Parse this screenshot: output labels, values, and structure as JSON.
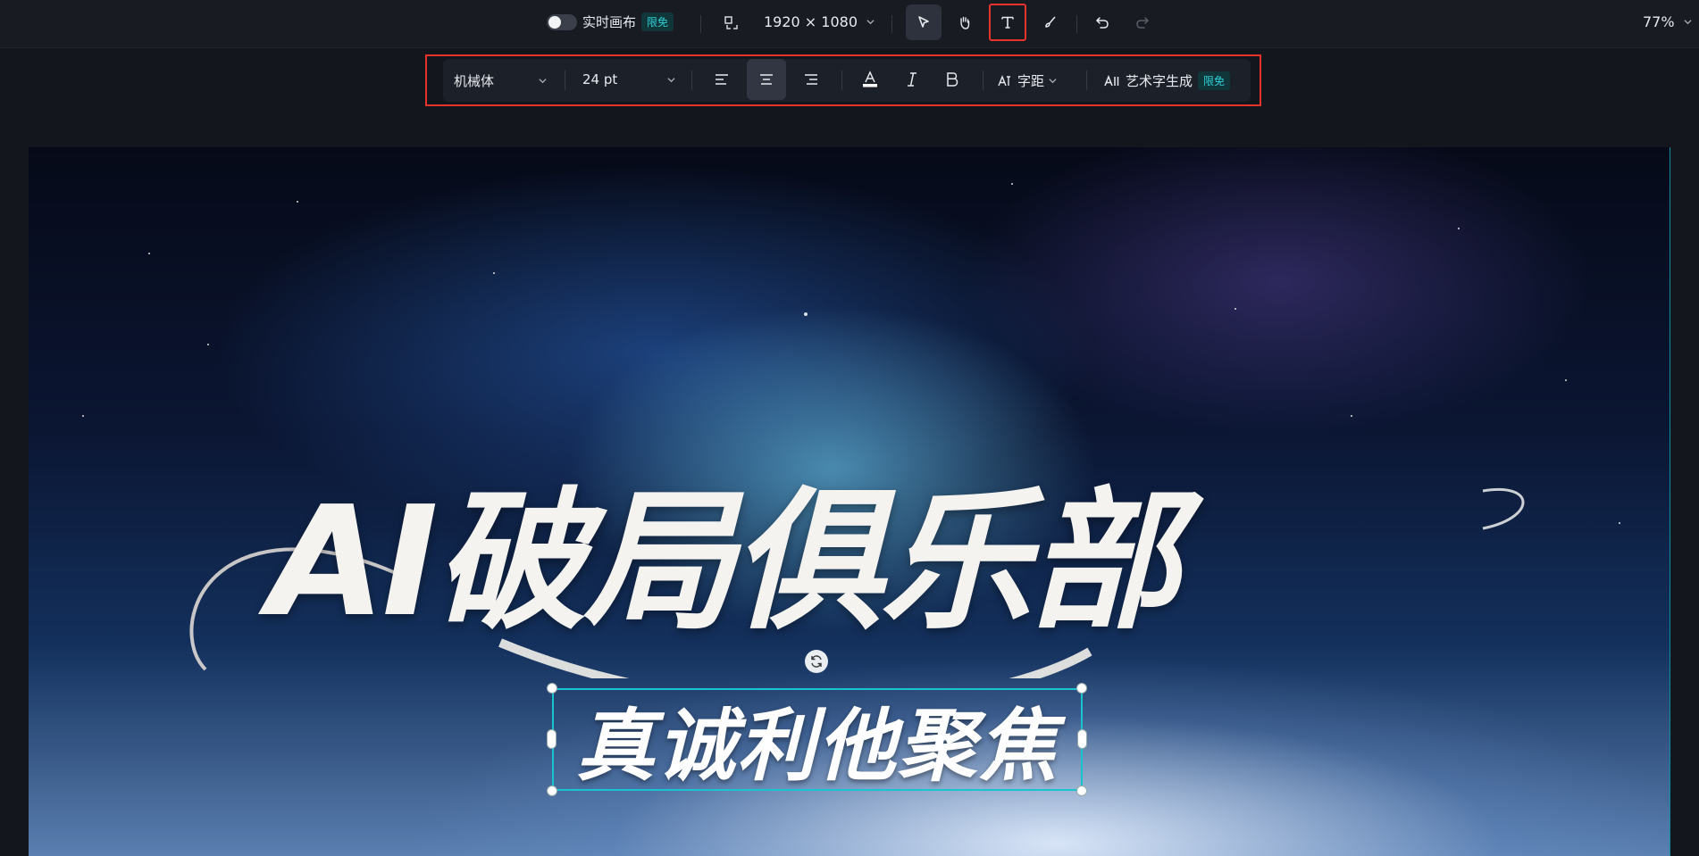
{
  "topbar": {
    "realtime_canvas_label": "实时画布",
    "realtime_badge": "限免",
    "canvas_size": "1920 × 1080",
    "zoom": "77%"
  },
  "format_bar": {
    "font_family": "机械体",
    "font_size": "24 pt",
    "letter_spacing_label": "字距",
    "art_text_label": "艺术字生成",
    "art_text_badge": "限免",
    "text_color": "#ffffff"
  },
  "canvas": {
    "title_text": "AI破局俱乐部",
    "subtitle_text": "真诚利他聚焦"
  },
  "colors": {
    "accent": "#18c4cf",
    "highlight_outline": "#e8322c"
  }
}
